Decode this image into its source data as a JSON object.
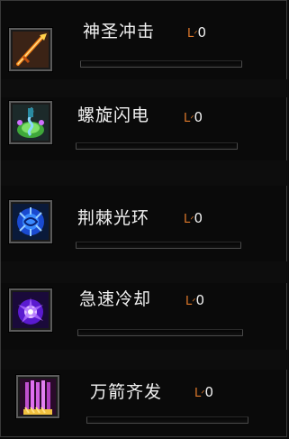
{
  "skills": [
    {
      "name": "神圣冲击",
      "level_prefix": "L",
      "level": "0",
      "progress": 0,
      "icon": "holy-strike-icon"
    },
    {
      "name": "螺旋闪电",
      "level_prefix": "L",
      "level": "0",
      "progress": 0,
      "icon": "spiral-lightning-icon"
    },
    {
      "name": "荆棘光环",
      "level_prefix": "L",
      "level": "0",
      "progress": 0,
      "icon": "thorns-aura-icon"
    },
    {
      "name": "急速冷却",
      "level_prefix": "L",
      "level": "0",
      "progress": 0,
      "icon": "rapid-cooldown-icon"
    },
    {
      "name": "万箭齐发",
      "level_prefix": "L",
      "level": "0",
      "progress": 0,
      "icon": "arrow-volley-icon"
    }
  ],
  "colors": {
    "level_accent": "#e07a2a",
    "text": "#f2f2f2"
  }
}
